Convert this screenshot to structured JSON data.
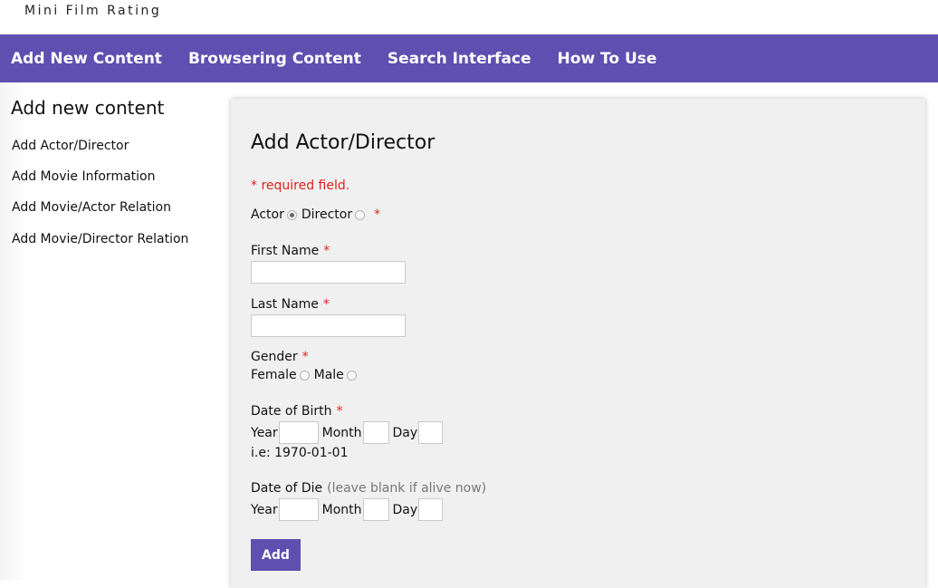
{
  "brand": "Mini Film Rating",
  "nav": {
    "items": [
      "Add New Content",
      "Browsering Content",
      "Search Interface",
      "How To Use"
    ]
  },
  "sidebar": {
    "title": "Add new content",
    "items": [
      "Add Actor/Director",
      "Add Movie Information",
      "Add Movie/Actor Relation",
      "Add Movie/Director Relation"
    ]
  },
  "form": {
    "title": "Add Actor/Director",
    "required_note": "* required field.",
    "required_marker": "*",
    "role": {
      "options": [
        "Actor",
        "Director"
      ],
      "selected": "Actor"
    },
    "first_name": {
      "label": "First Name",
      "value": ""
    },
    "last_name": {
      "label": "Last Name",
      "value": ""
    },
    "gender": {
      "label": "Gender",
      "options": [
        "Female",
        "Male"
      ],
      "selected": ""
    },
    "dob": {
      "label": "Date of Birth",
      "year_label": "Year",
      "month_label": "Month",
      "day_label": "Day",
      "example": "i.e: 1970-01-01"
    },
    "dod": {
      "label": "Date of Die",
      "hint": "(leave blank if alive now)",
      "year_label": "Year",
      "month_label": "Month",
      "day_label": "Day"
    },
    "submit_label": "Add"
  },
  "colors": {
    "accent": "#5e4fb0",
    "required": "#e02020",
    "panel_bg": "#f0f0f0",
    "hint": "#777777"
  }
}
